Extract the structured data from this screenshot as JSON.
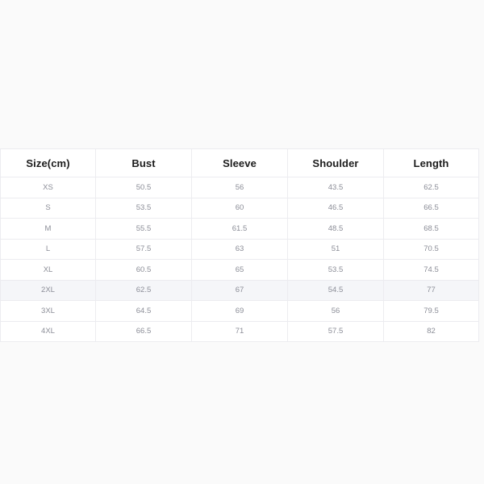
{
  "table": {
    "name": "size-chart",
    "columns": [
      "Size(cm)",
      "Bust",
      "Sleeve",
      "Shoulder",
      "Length"
    ],
    "highlight_row_index": 5,
    "highlight_color": "#f5f6f9",
    "border_color": "#ececf0",
    "header_text_color": "#1c1c1c",
    "cell_text_color": "#8b8d97",
    "cell_background": "#ffffff",
    "page_background": "#fafafa",
    "rows": [
      {
        "size": "XS",
        "bust": "50.5",
        "sleeve": "56",
        "shoulder": "43.5",
        "length": "62.5"
      },
      {
        "size": "S",
        "bust": "53.5",
        "sleeve": "60",
        "shoulder": "46.5",
        "length": "66.5"
      },
      {
        "size": "M",
        "bust": "55.5",
        "sleeve": "61.5",
        "shoulder": "48.5",
        "length": "68.5"
      },
      {
        "size": "L",
        "bust": "57.5",
        "sleeve": "63",
        "shoulder": "51",
        "length": "70.5"
      },
      {
        "size": "XL",
        "bust": "60.5",
        "sleeve": "65",
        "shoulder": "53.5",
        "length": "74.5"
      },
      {
        "size": "2XL",
        "bust": "62.5",
        "sleeve": "67",
        "shoulder": "54.5",
        "length": "77"
      },
      {
        "size": "3XL",
        "bust": "64.5",
        "sleeve": "69",
        "shoulder": "56",
        "length": "79.5"
      },
      {
        "size": "4XL",
        "bust": "66.5",
        "sleeve": "71",
        "shoulder": "57.5",
        "length": "82"
      }
    ]
  }
}
